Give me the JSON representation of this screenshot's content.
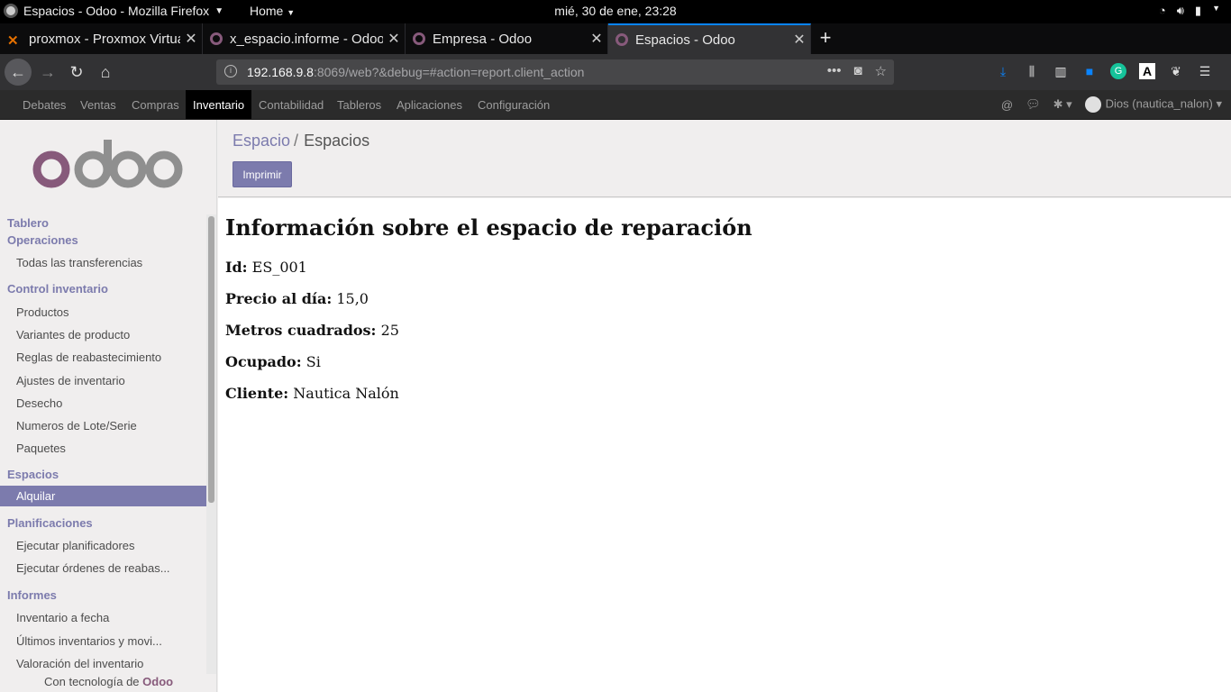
{
  "system": {
    "app_menu": "Espacios - Odoo - Mozilla Firefox",
    "home_menu": "Home",
    "clock": "mié, 30 de ene, 23:28"
  },
  "tabs": [
    {
      "label": "proxmox - Proxmox Virtua"
    },
    {
      "label": "x_espacio.informe - Odoo"
    },
    {
      "label": "Empresa - Odoo"
    },
    {
      "label": "Espacios - Odoo"
    }
  ],
  "url": {
    "host": "192.168.9.8",
    "rest": ":8069/web?&debug=#action=report.client_action"
  },
  "odoo_menu": {
    "items": [
      "Debates",
      "Ventas",
      "Compras",
      "Inventario",
      "Contabilidad",
      "Tableros",
      "Aplicaciones",
      "Configuración"
    ],
    "active": "Inventario",
    "user": "Dios (nautica_nalon)"
  },
  "sidebar": {
    "dashboard": "Tablero",
    "sections": [
      {
        "title": "Operaciones",
        "items": [
          "Todas las transferencias"
        ]
      },
      {
        "title": "Control inventario",
        "items": [
          "Productos",
          "Variantes de producto",
          "Reglas de reabastecimiento",
          "Ajustes de inventario",
          "Desecho",
          "Numeros de Lote/Serie",
          "Paquetes"
        ]
      },
      {
        "title": "Espacios",
        "items": [
          "Alquilar"
        ]
      },
      {
        "title": "Planificaciones",
        "items": [
          "Ejecutar planificadores",
          "Ejecutar órdenes de reabas..."
        ]
      },
      {
        "title": "Informes",
        "items": [
          "Inventario a fecha",
          "Últimos inventarios y movi...",
          "Valoración del inventario"
        ]
      }
    ],
    "active_item": "Alquilar",
    "powered_prefix": "Con tecnología de",
    "powered_brand": "Odoo"
  },
  "breadcrumb": {
    "parent": "Espacio",
    "separator": "/",
    "current": "Espacios"
  },
  "print_button": "Imprimir",
  "report": {
    "title": "Información sobre el espacio de reparación",
    "fields": [
      {
        "label": "Id:",
        "value": "ES_001"
      },
      {
        "label": "Precio al día:",
        "value": "15,0"
      },
      {
        "label": "Metros cuadrados:",
        "value": "25"
      },
      {
        "label": "Ocupado:",
        "value": "Si"
      },
      {
        "label": "Cliente:",
        "value": "Nautica Nalón"
      }
    ]
  },
  "colors": {
    "odoo_purple": "#875a7b",
    "accent": "#7c7bad",
    "firefox_blue": "#0a84ff"
  }
}
